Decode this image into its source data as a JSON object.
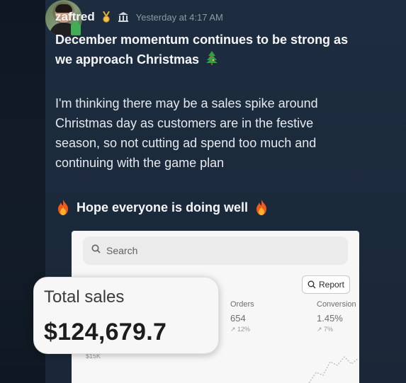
{
  "message": {
    "username": "zaftred",
    "timestamp": "Yesterday at 4:17 AM",
    "title_line1": "December momentum continues to be strong as",
    "title_line2": "we approach Christmas",
    "body_line1": "I'm thinking there may be a sales spike around",
    "body_line2": "Christmas day as customers are in the festive",
    "body_line3": "season, so not cutting ad spend too much and",
    "body_line4": "continuing with the game plan",
    "closing": "Hope everyone is doing well"
  },
  "icons": {
    "medal": "medal-icon",
    "bank": "bank-icon",
    "tree": "christmas-tree-icon",
    "fire": "fire-icon"
  },
  "embed": {
    "search_placeholder": "Search",
    "report_label": "Report",
    "orders": {
      "label": "Orders",
      "value": "654",
      "delta": "↗ 12%"
    },
    "conversion": {
      "label": "Conversion",
      "value": "1.45%",
      "delta": "↗ 7%"
    },
    "axis_label": "$15K",
    "total_sales": {
      "label": "Total sales",
      "value": "$124,679.7"
    }
  }
}
